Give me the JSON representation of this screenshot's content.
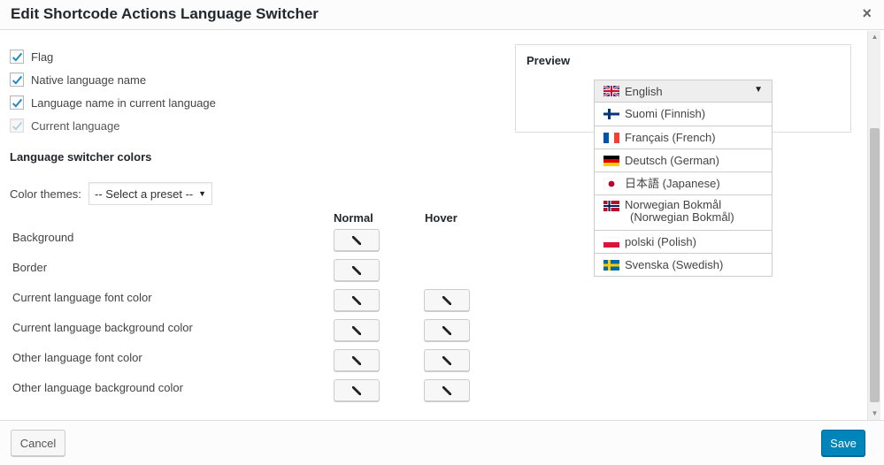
{
  "dialog": {
    "title": "Edit Shortcode Actions Language Switcher",
    "close_glyph": "×"
  },
  "options": {
    "checkboxes": [
      {
        "label": "Flag",
        "checked": true,
        "disabled": false
      },
      {
        "label": "Native language name",
        "checked": true,
        "disabled": false
      },
      {
        "label": "Language name in current language",
        "checked": true,
        "disabled": false
      },
      {
        "label": "Current language",
        "checked": true,
        "disabled": true
      }
    ]
  },
  "colors": {
    "heading": "Language switcher colors",
    "theme_label": "Color themes:",
    "theme_select_value": "-- Select a preset --",
    "col_normal": "Normal",
    "col_hover": "Hover",
    "rows": [
      {
        "label": "Background",
        "normal": true,
        "hover": false
      },
      {
        "label": "Border",
        "normal": true,
        "hover": false
      },
      {
        "label": "Current language font color",
        "normal": true,
        "hover": true
      },
      {
        "label": "Current language background color",
        "normal": true,
        "hover": true
      },
      {
        "label": "Other language font color",
        "normal": true,
        "hover": true
      },
      {
        "label": "Other language background color",
        "normal": true,
        "hover": true
      }
    ]
  },
  "preview": {
    "title": "Preview",
    "current": {
      "label": "English",
      "flag": "uk-flag-icon"
    },
    "languages": [
      {
        "label": "Suomi (Finnish)",
        "flag": "finland-flag-icon"
      },
      {
        "label": "Français (French)",
        "flag": "france-flag-icon"
      },
      {
        "label": "Deutsch (German)",
        "flag": "germany-flag-icon"
      },
      {
        "label": "日本語 (Japanese)",
        "flag": "japan-flag-icon"
      },
      {
        "label": "Norwegian Bokmål (Norwegian Bokmål)",
        "flag": "norway-flag-icon"
      },
      {
        "label": "polski (Polish)",
        "flag": "poland-flag-icon"
      },
      {
        "label": "Svenska (Swedish)",
        "flag": "sweden-flag-icon"
      }
    ]
  },
  "footer": {
    "cancel_label": "Cancel",
    "save_label": "Save"
  },
  "theme": {
    "accent": "#0085ba",
    "check_color": "#1e8cbe"
  }
}
